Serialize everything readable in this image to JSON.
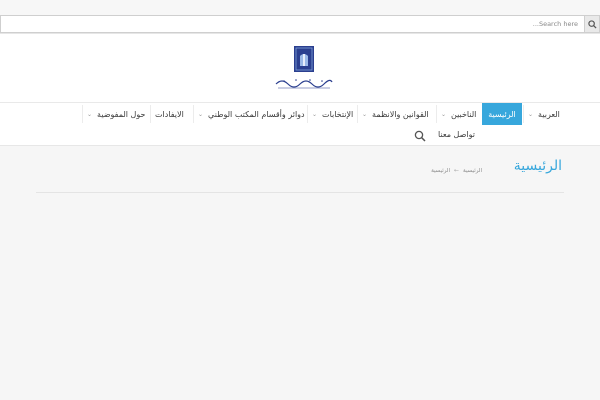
{
  "search": {
    "placeholder": "Search here..."
  },
  "nav": {
    "items": [
      {
        "label": "العربية",
        "has_dropdown": true
      },
      {
        "label": "الرئيسية",
        "active": true
      },
      {
        "label": "الناخبين",
        "has_dropdown": true
      },
      {
        "label": "القوانين والانظمة",
        "has_dropdown": true
      },
      {
        "label": "الإنتخابات",
        "has_dropdown": true
      },
      {
        "label": "دوائر وأقسام المكتب الوطني",
        "has_dropdown": true
      },
      {
        "label": "الايفادات"
      },
      {
        "label": "حول المفوضية",
        "has_dropdown": true
      },
      {
        "label": "تواصل معنا"
      }
    ]
  },
  "page": {
    "title": "الرئيسية",
    "breadcrumb": [
      "الرئيسية",
      "الرئيسية"
    ]
  },
  "colors": {
    "accent": "#37a7dc",
    "logo_blue": "#2b3f8f"
  },
  "icons": {
    "search": "search-icon",
    "caret": "chevron-down-icon"
  }
}
